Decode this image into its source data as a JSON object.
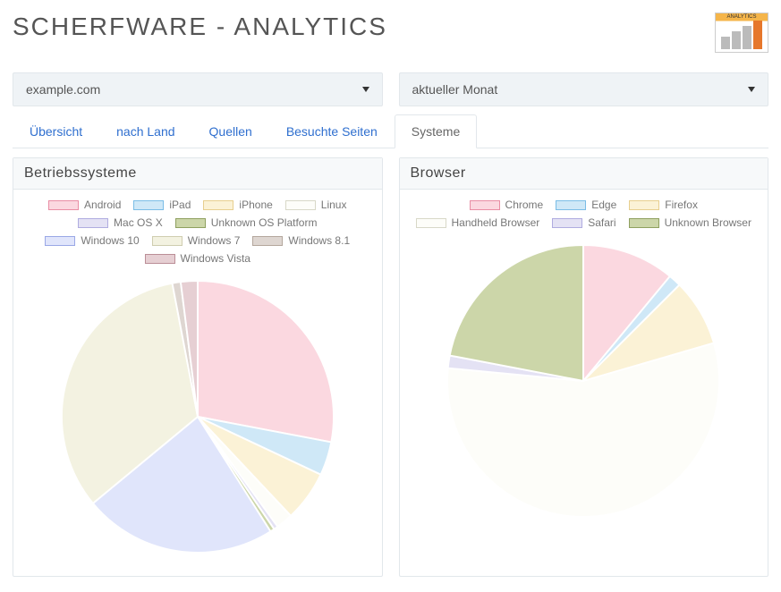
{
  "header": {
    "title": "SCHERFWARE - ANALYTICS"
  },
  "selects": {
    "site": "example.com",
    "range": "aktueller Monat"
  },
  "tabs": [
    {
      "id": "overview",
      "label": "Übersicht",
      "active": false
    },
    {
      "id": "country",
      "label": "nach Land",
      "active": false
    },
    {
      "id": "sources",
      "label": "Quellen",
      "active": false
    },
    {
      "id": "pages",
      "label": "Besuchte Seiten",
      "active": false
    },
    {
      "id": "systems",
      "label": "Systeme",
      "active": true
    }
  ],
  "panels": {
    "os": {
      "title": "Betriebssysteme"
    },
    "browser": {
      "title": "Browser"
    }
  },
  "colors": {
    "pink": {
      "fill": "#fbd8e0",
      "stroke": "#e98da4"
    },
    "lightblue": {
      "fill": "#cfe8f7",
      "stroke": "#7bbde6"
    },
    "cream": {
      "fill": "#fbf2d6",
      "stroke": "#e7cf8f"
    },
    "offwhite": {
      "fill": "#fdfdf9",
      "stroke": "#d8d8c8"
    },
    "lavender": {
      "fill": "#e4e2f4",
      "stroke": "#b0ace0"
    },
    "olive": {
      "fill": "#ccd6a9",
      "stroke": "#8fa060"
    },
    "periwinkle": {
      "fill": "#e0e5fb",
      "stroke": "#9aa8e6"
    },
    "beige": {
      "fill": "#f3f2e1",
      "stroke": "#cfcdb0"
    },
    "taupe": {
      "fill": "#ded6d1",
      "stroke": "#b4a79d"
    },
    "mauve": {
      "fill": "#e6cfd3",
      "stroke": "#bb8e97"
    }
  },
  "chart_data": [
    {
      "id": "os",
      "type": "pie",
      "title": "Betriebssysteme",
      "series": [
        {
          "name": "Android",
          "value": 28,
          "color": "pink"
        },
        {
          "name": "iPad",
          "value": 4,
          "color": "lightblue"
        },
        {
          "name": "iPhone",
          "value": 6,
          "color": "cream"
        },
        {
          "name": "Linux",
          "value": 2,
          "color": "offwhite"
        },
        {
          "name": "Mac OS X",
          "value": 0.5,
          "color": "lavender"
        },
        {
          "name": "Unknown OS Platform",
          "value": 0.5,
          "color": "olive"
        },
        {
          "name": "Windows 10",
          "value": 23,
          "color": "periwinkle"
        },
        {
          "name": "Windows 7",
          "value": 33,
          "color": "beige"
        },
        {
          "name": "Windows 8.1",
          "value": 1,
          "color": "taupe"
        },
        {
          "name": "Windows Vista",
          "value": 2,
          "color": "mauve"
        }
      ]
    },
    {
      "id": "browser",
      "type": "pie",
      "title": "Browser",
      "series": [
        {
          "name": "Chrome",
          "value": 11,
          "color": "pink"
        },
        {
          "name": "Edge",
          "value": 1.5,
          "color": "lightblue"
        },
        {
          "name": "Firefox",
          "value": 8,
          "color": "cream"
        },
        {
          "name": "Handheld Browser",
          "value": 56,
          "color": "offwhite"
        },
        {
          "name": "Safari",
          "value": 1.5,
          "color": "lavender"
        },
        {
          "name": "Unknown Browser",
          "value": 22,
          "color": "olive"
        }
      ]
    }
  ]
}
